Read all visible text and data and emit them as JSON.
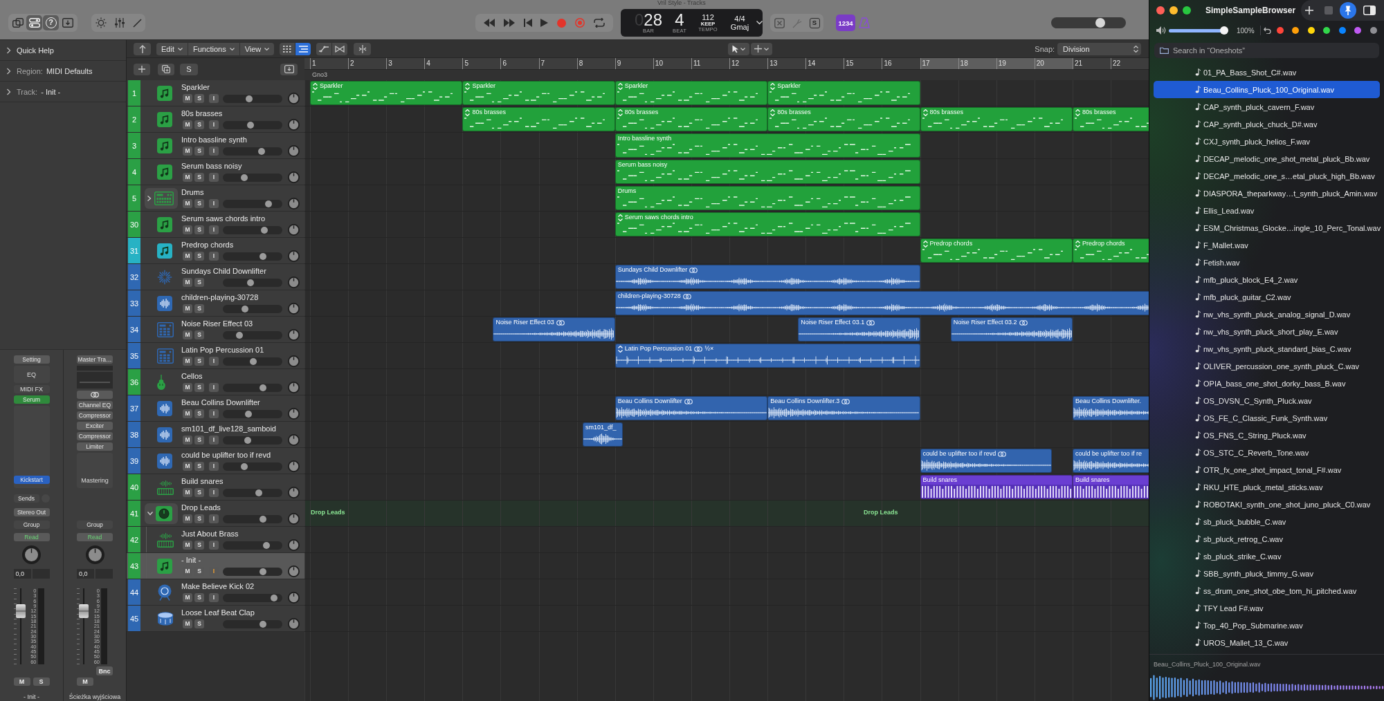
{
  "window": {
    "title": "Vril Style - Tracks"
  },
  "toolbar": {
    "view_buttons": [
      {
        "kind": "library",
        "selected": false
      },
      {
        "kind": "toggles",
        "selected": true
      },
      {
        "kind": "help",
        "label": "?",
        "selected": true
      },
      {
        "kind": "download",
        "selected": false
      }
    ],
    "solo_button": "S",
    "count_in": "1234",
    "master_volume": {
      "level": 0.68
    }
  },
  "lcd": {
    "bar_lead": "0",
    "bar": "28",
    "bar_caption": "BAR",
    "beat": "4",
    "beat_caption": "BEAT",
    "tempo": "112",
    "tempo_mode": "KEEP",
    "tempo_caption": "TEMPO",
    "signature": "4/4",
    "key": "Gmaj"
  },
  "inspector": {
    "sections": [
      {
        "label": "Quick Help",
        "expanded": false
      },
      {
        "label": "Region:",
        "value": "MIDI Defaults",
        "expanded": false
      },
      {
        "label": "Track:",
        "value": "- Init -",
        "expanded": false
      }
    ],
    "strips": [
      {
        "slots": [
          {
            "kind": "button",
            "text": "Setting"
          },
          {
            "kind": "box",
            "text": "EQ"
          },
          {
            "kind": "label",
            "text": "MIDI FX"
          },
          {
            "kind": "plugin",
            "text": "Serum",
            "color": "#2f8a3c"
          },
          {
            "kind": "area",
            "plugins": [
              {
                "text": "Kickstart",
                "color": "#2a62c2"
              }
            ]
          }
        ],
        "sends": "Sends",
        "output": "Stereo Out",
        "group": "Group",
        "automation": "Read",
        "volume": "0,0",
        "fader": {
          "level": 0.74
        },
        "meter_scale": [
          "0",
          "3",
          "6",
          "9",
          "12",
          "15",
          "18",
          "21",
          "24",
          "30",
          "35",
          "40",
          "45",
          "50",
          "60"
        ],
        "buttons": [
          "M",
          "S"
        ],
        "name": "- Init -"
      },
      {
        "slots": [
          {
            "kind": "button",
            "text": "Master Tra…"
          },
          {
            "kind": "eq-thumb"
          },
          {
            "kind": "link"
          },
          {
            "kind": "plugin",
            "text": "Channel EQ",
            "color": "#5a5a5a"
          },
          {
            "kind": "plugin",
            "text": "Compressor",
            "color": "#5a5a5a"
          },
          {
            "kind": "plugin",
            "text": "Exciter",
            "color": "#5a5a5a"
          },
          {
            "kind": "plugin",
            "text": "Compressor",
            "color": "#5a5a5a"
          },
          {
            "kind": "plugin",
            "text": "Limiter",
            "color": "#5a5a5a"
          },
          {
            "kind": "area",
            "label": "Mastering"
          }
        ],
        "group": "Group",
        "automation": "Read",
        "volume": "0,0",
        "fader": {
          "level": 0.74
        },
        "meter_scale": [
          "0",
          "3",
          "6",
          "9",
          "12",
          "15",
          "18",
          "21",
          "24",
          "30",
          "35",
          "40",
          "45",
          "50",
          "60"
        ],
        "bounce": "Bnc",
        "buttons": [
          "M"
        ],
        "name": "Ścieżka wyjściowa"
      }
    ]
  },
  "arrange": {
    "menus": [
      "Edit",
      "Functions",
      "View"
    ],
    "view_modes": [
      {
        "kind": "grid",
        "selected": false
      },
      {
        "kind": "list",
        "selected": true
      }
    ],
    "header_solo": "S",
    "snap_label": "Snap:",
    "snap_value": "Division",
    "ruler": {
      "bars": [
        "1",
        "2",
        "3",
        "4",
        "5",
        "6",
        "7",
        "8",
        "9",
        "10",
        "11",
        "12",
        "13",
        "14",
        "15",
        "16",
        "17",
        "18",
        "19",
        "20",
        "21",
        "22"
      ]
    },
    "markers": [
      {
        "text": "Gno3"
      }
    ],
    "tracks": [
      {
        "number": "1",
        "name": "Sparkler",
        "kind": "synth",
        "color": "#2ba045",
        "mute": "M",
        "solo": "S",
        "input": "I",
        "input_on": false,
        "level": 0.43,
        "selected": false,
        "regions": [
          {
            "name": "Sparkler",
            "kind": "midi",
            "color": "#22a13b",
            "looped": true,
            "linked": false
          },
          {
            "name": "Sparkler",
            "kind": "midi",
            "color": "#22a13b",
            "looped": true,
            "linked": false
          },
          {
            "name": "Sparkler",
            "kind": "midi",
            "color": "#22a13b",
            "looped": true,
            "linked": false
          },
          {
            "name": "Sparkler",
            "kind": "midi",
            "color": "#22a13b",
            "looped": true,
            "linked": false
          }
        ]
      },
      {
        "number": "2",
        "name": "80s brasses",
        "kind": "synth",
        "color": "#2ba045",
        "mute": "M",
        "solo": "S",
        "input": "I",
        "input_on": false,
        "level": 0.46,
        "selected": false,
        "regions": [
          {
            "name": "80s brasses",
            "kind": "midi",
            "color": "#22a13b",
            "looped": true,
            "linked": false
          },
          {
            "name": "80s brasses",
            "kind": "midi",
            "color": "#22a13b",
            "looped": true,
            "linked": false
          },
          {
            "name": "80s brasses",
            "kind": "midi",
            "color": "#22a13b",
            "looped": true,
            "linked": false
          },
          {
            "name": "80s brasses",
            "kind": "midi",
            "color": "#22a13b",
            "looped": true,
            "linked": false
          },
          {
            "name": "80s brasses",
            "kind": "midi",
            "color": "#22a13b",
            "looped": true,
            "linked": false
          }
        ]
      },
      {
        "number": "3",
        "name": "Intro bassline synth",
        "kind": "synth",
        "color": "#2ba045",
        "mute": "M",
        "solo": "S",
        "input": "I",
        "input_on": false,
        "level": 0.67,
        "selected": false,
        "regions": [
          {
            "name": "Intro bassline synth",
            "kind": "midi",
            "color": "#22a13b",
            "looped": false,
            "linked": false
          }
        ]
      },
      {
        "number": "4",
        "name": "Serum bass noisy",
        "kind": "synth",
        "color": "#2ba045",
        "mute": "M",
        "solo": "S",
        "input": "I",
        "input_on": false,
        "level": 0.34,
        "selected": false,
        "regions": [
          {
            "name": "Serum bass noisy",
            "kind": "midi",
            "color": "#22a13b",
            "looped": false,
            "linked": false
          }
        ]
      },
      {
        "number": "5",
        "name": "Drums",
        "kind": "drum-machine",
        "color": "#2ba045",
        "mute": "M",
        "solo": "S",
        "input": "I",
        "input_on": false,
        "level": 0.8,
        "selected": false,
        "expanded": false,
        "regions": [
          {
            "name": "Drums",
            "kind": "midi",
            "color": "#22a13b",
            "looped": false,
            "linked": false
          }
        ]
      },
      {
        "number": "30",
        "name": "Serum saws chords intro",
        "kind": "synth",
        "color": "#2ba045",
        "mute": "M",
        "solo": "S",
        "input": "I",
        "input_on": false,
        "level": 0.73,
        "selected": false,
        "regions": [
          {
            "name": "Serum saws chords intro",
            "kind": "midi",
            "color": "#22a13b",
            "looped": true,
            "linked": false
          }
        ]
      },
      {
        "number": "31",
        "name": "Predrop chords",
        "kind": "synth",
        "color": "#27b2c4",
        "mute": "M",
        "solo": "S",
        "input": "I",
        "input_on": false,
        "level": 0.7,
        "selected": false,
        "regions": [
          {
            "name": "Predrop chords",
            "kind": "midi",
            "color": "#22a13b",
            "looped": true,
            "linked": false
          },
          {
            "name": "Predrop chords",
            "kind": "midi",
            "color": "#22a13b",
            "looped": true,
            "linked": false
          }
        ]
      },
      {
        "number": "32",
        "name": "Sundays Child Downlifter",
        "kind": "fx",
        "color": "#2f68b3",
        "mute": "M",
        "solo": "S",
        "level": 0.46,
        "selected": false,
        "regions": [
          {
            "name": "Sundays Child Downlifter",
            "kind": "noise",
            "color": "#3264ae",
            "looped": false,
            "linked": true
          }
        ]
      },
      {
        "number": "33",
        "name": "children-playing-30728",
        "kind": "audio",
        "color": "#2f68b3",
        "mute": "M",
        "solo": "S",
        "level": 0.36,
        "selected": false,
        "regions": [
          {
            "name": "children-playing-30728",
            "kind": "noise",
            "color": "#3264ae",
            "looped": false,
            "linked": true
          }
        ]
      },
      {
        "number": "34",
        "name": "Noise Riser Effect 03",
        "kind": "pad-sampler",
        "color": "#2f68b3",
        "mute": "M",
        "solo": "S",
        "level": 0.25,
        "selected": false,
        "regions": [
          {
            "name": "Noise Riser Effect 03",
            "kind": "swell",
            "color": "#3264ae",
            "looped": false,
            "linked": true
          },
          {
            "name": "Noise Riser Effect 03.1",
            "kind": "swell",
            "color": "#3264ae",
            "looped": false,
            "linked": true
          },
          {
            "name": "Noise Riser Effect 03.2",
            "kind": "swell",
            "color": "#3264ae",
            "looped": false,
            "linked": true
          }
        ]
      },
      {
        "number": "35",
        "name": "Latin Pop Percussion 01",
        "kind": "pad-sampler",
        "color": "#2f68b3",
        "mute": "M",
        "solo": "S",
        "input": "I",
        "input_on": false,
        "level": 0.51,
        "selected": false,
        "regions": [
          {
            "name": "Latin Pop Percussion 01",
            "kind": "hits",
            "color": "#3264ae",
            "looped": true,
            "linked": true,
            "extra": "½×"
          }
        ]
      },
      {
        "number": "36",
        "name": "Cellos",
        "kind": "strings",
        "color": "#2ba045",
        "mute": "M",
        "solo": "S",
        "input": "I",
        "input_on": false,
        "level": 0.7,
        "selected": false
      },
      {
        "number": "37",
        "name": "Beau Collins Downlifter",
        "kind": "audio",
        "color": "#2f68b3",
        "mute": "M",
        "solo": "S",
        "input": "I",
        "input_on": false,
        "level": 0.42,
        "selected": false,
        "regions": [
          {
            "name": "Beau Collins Downlifter",
            "kind": "fade",
            "color": "#3264ae",
            "looped": false,
            "linked": true
          },
          {
            "name": "Beau Collins Downlifter.3",
            "kind": "fade",
            "color": "#3264ae",
            "looped": false,
            "linked": true
          },
          {
            "name": "Beau Collins Downlifter.",
            "kind": "fade",
            "color": "#3264ae",
            "looped": false,
            "linked": false
          }
        ]
      },
      {
        "number": "38",
        "name": "sm101_df_live128_samboid",
        "kind": "audio",
        "color": "#2f68b3",
        "mute": "M",
        "solo": "S",
        "input": "I",
        "input_on": false,
        "level": 0.41,
        "selected": false,
        "regions": [
          {
            "name": "sm101_df_",
            "kind": "burst",
            "color": "#3264ae",
            "looped": false,
            "linked": false
          }
        ]
      },
      {
        "number": "39",
        "name": "could be uplifter too if revd",
        "kind": "audio",
        "color": "#2f68b3",
        "mute": "M",
        "solo": "S",
        "input": "I",
        "input_on": false,
        "level": 0.34,
        "selected": false,
        "regions": [
          {
            "name": "could be uplifter too if revd",
            "kind": "fade",
            "color": "#3264ae",
            "looped": false,
            "linked": true
          },
          {
            "name": "could be uplifter too if re",
            "kind": "fade",
            "color": "#3264ae",
            "looped": false,
            "linked": false
          }
        ]
      },
      {
        "number": "40",
        "name": "Build snares",
        "kind": "keys-sampler",
        "color": "#2ba045",
        "mute": "M",
        "solo": "S",
        "input": "I",
        "input_on": false,
        "level": 0.62,
        "selected": false,
        "regions": [
          {
            "name": "Build snares",
            "kind": "pattern",
            "color": "#6a3ed2",
            "looped": false,
            "linked": false
          },
          {
            "name": "Build snares",
            "kind": "pattern",
            "color": "#6a3ed2",
            "looped": false,
            "linked": false
          }
        ]
      },
      {
        "number": "41",
        "name": "Drop Leads",
        "kind": "stack",
        "color": "#2ba045",
        "mute": "M",
        "solo": "S",
        "input": "I",
        "input_on": false,
        "level": 0.7,
        "selected": false,
        "expanded": true,
        "regions": [
          {
            "name": "Drop Leads",
            "kind": "stack",
            "color": "#8ae493"
          },
          {
            "name": "Drop Leads",
            "kind": "stack",
            "color": "#8ae493"
          }
        ],
        "children": [
          {
            "number": "42",
            "name": "Just About Brass",
            "kind": "keys-sampler",
            "color": "#2ba045",
            "mute": "M",
            "solo": "S",
            "input": "I",
            "input_on": false,
            "level": 0.76,
            "selected": false
          },
          {
            "number": "43",
            "name": "- Init -",
            "kind": "synth",
            "color": "#2ba045",
            "mute": "M",
            "solo": "S",
            "input": "I",
            "input_on": true,
            "level": 0.7,
            "selected": true
          }
        ]
      },
      {
        "number": "44",
        "name": "Make Believe Kick 02",
        "kind": "kick",
        "color": "#2f68b3",
        "mute": "M",
        "solo": "S",
        "input": "I",
        "input_on": false,
        "level": 0.91,
        "selected": false
      },
      {
        "number": "45",
        "name": "Loose Leaf Beat Clap",
        "kind": "snare",
        "color": "#2f68b3",
        "mute": "M",
        "solo": "S",
        "level": 0.7,
        "selected": false
      }
    ]
  },
  "browser": {
    "title": "SimpleSampleBrowser",
    "pinned": true,
    "volume": {
      "level": 1.0
    },
    "volume_reading": "100%",
    "color_tags": [
      {
        "color": "#ff453a"
      },
      {
        "color": "#ff9f0a"
      },
      {
        "color": "#ffd60a"
      },
      {
        "color": "#32d74b"
      },
      {
        "color": "#0a84ff"
      },
      {
        "color": "#bf5af2"
      },
      {
        "color": "#8e8e93"
      }
    ],
    "search": {
      "placeholder": "Search in “Oneshots”"
    },
    "files": [
      {
        "name": "01_PA_Bass_Shot_C#.wav",
        "selected": false
      },
      {
        "name": "Beau_Collins_Pluck_100_Original.wav",
        "selected": true
      },
      {
        "name": "CAP_synth_pluck_cavern_F.wav",
        "selected": false
      },
      {
        "name": "CAP_synth_pluck_chuck_D#.wav",
        "selected": false
      },
      {
        "name": "CXJ_synth_pluck_helios_F.wav",
        "selected": false
      },
      {
        "name": "DECAP_melodic_one_shot_metal_pluck_Bb.wav",
        "selected": false
      },
      {
        "name": "DECAP_melodic_one_s…etal_pluck_high_Bb.wav",
        "selected": false
      },
      {
        "name": "DIASPORA_theparkway…t_synth_pluck_Amin.wav",
        "selected": false
      },
      {
        "name": "Ellis_Lead.wav",
        "selected": false
      },
      {
        "name": "ESM_Christmas_Glocke…ingle_10_Perc_Tonal.wav",
        "selected": false
      },
      {
        "name": "F_Mallet.wav",
        "selected": false
      },
      {
        "name": "Fetish.wav",
        "selected": false
      },
      {
        "name": "mfb_pluck_block_E4_2.wav",
        "selected": false
      },
      {
        "name": "mfb_pluck_guitar_C2.wav",
        "selected": false
      },
      {
        "name": "nw_vhs_synth_pluck_analog_signal_D.wav",
        "selected": false
      },
      {
        "name": "nw_vhs_synth_pluck_short_play_E.wav",
        "selected": false
      },
      {
        "name": "nw_vhs_synth_pluck_standard_bias_C.wav",
        "selected": false
      },
      {
        "name": "OLIVER_percussion_one_synth_pluck_C.wav",
        "selected": false
      },
      {
        "name": "OPIA_bass_one_shot_dorky_bass_B.wav",
        "selected": false
      },
      {
        "name": "OS_DVSN_C_Synth_Pluck.wav",
        "selected": false
      },
      {
        "name": "OS_FE_C_Classic_Funk_Synth.wav",
        "selected": false
      },
      {
        "name": "OS_FNS_C_String_Pluck.wav",
        "selected": false
      },
      {
        "name": "OS_STC_C_Reverb_Tone.wav",
        "selected": false
      },
      {
        "name": "OTR_fx_one_shot_impact_tonal_F#.wav",
        "selected": false
      },
      {
        "name": "RKU_HTE_pluck_metal_sticks.wav",
        "selected": false
      },
      {
        "name": "ROBOTAKI_synth_one_shot_juno_pluck_C0.wav",
        "selected": false
      },
      {
        "name": "sb_pluck_bubble_C.wav",
        "selected": false
      },
      {
        "name": "sb_pluck_retrog_C.wav",
        "selected": false
      },
      {
        "name": "sb_pluck_strike_C.wav",
        "selected": false
      },
      {
        "name": "SBB_synth_pluck_timmy_G.wav",
        "selected": false
      },
      {
        "name": "ss_drum_one_shot_obe_tom_hi_pitched.wav",
        "selected": false
      },
      {
        "name": "TFY Lead F#.wav",
        "selected": false
      },
      {
        "name": "Top_40_Pop_Submarine.wav",
        "selected": false
      },
      {
        "name": "UROS_Mallet_13_C.wav",
        "selected": false
      }
    ],
    "preview": {
      "name": "Beau_Collins_Pluck_100_Original.wav"
    }
  }
}
